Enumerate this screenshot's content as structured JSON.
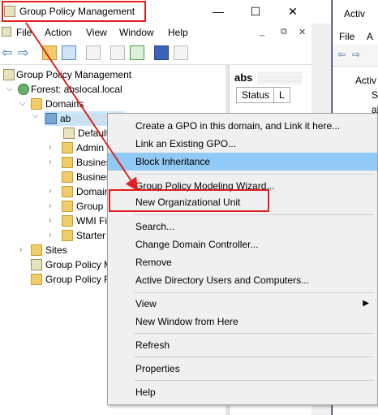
{
  "window": {
    "title": "Group Policy Management",
    "caption_buttons": {
      "minimize": "—",
      "maximize": "☐",
      "close": "✕"
    }
  },
  "menu": {
    "items": [
      "File",
      "Action",
      "View",
      "Window",
      "Help"
    ],
    "mdi": {
      "minimize": "_",
      "restore": "⧉",
      "close": "✕"
    }
  },
  "tree": {
    "root": "Group Policy Management",
    "forest": "Forest: abslocal.local",
    "domains": "Domains",
    "domain": "ab",
    "children": [
      "Default",
      "Admin",
      "Busines",
      "Busines",
      "Domain",
      "Group",
      "WMI Fi",
      "Starter"
    ],
    "sites": "Sites",
    "modeling": "Group Policy M",
    "results": "Group Policy R"
  },
  "right_pane": {
    "title": "abs",
    "tabs": [
      "Status",
      "L"
    ]
  },
  "background_window": {
    "title": "Activ",
    "menu": [
      "File",
      "A"
    ],
    "tree": [
      "Activ",
      "Sa",
      "ab"
    ]
  },
  "context_menu": {
    "items": [
      "Create a GPO in this domain, and Link it here...",
      "Link an Existing GPO...",
      "Block Inheritance",
      "Group Policy Modeling Wizard...",
      "New Organizational Unit",
      "Search...",
      "Change Domain Controller...",
      "Remove",
      "Active Directory Users and Computers...",
      "View",
      "New Window from Here",
      "Refresh",
      "Properties",
      "Help"
    ],
    "highlighted": "Block Inheritance",
    "annotated": "New Organizational Unit",
    "submenu_arrow": "▶"
  },
  "accent_colors": {
    "highlight": "#91c9f7",
    "annotation": "#e0201e",
    "selection": "#cce8ff"
  }
}
